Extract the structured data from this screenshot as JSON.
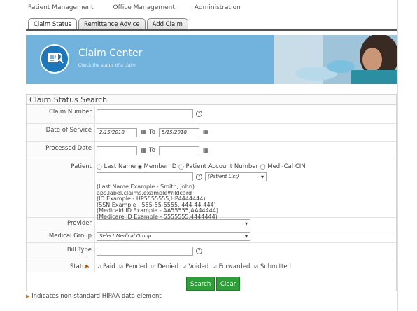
{
  "topnav": [
    "Patient Management",
    "Office Management",
    "Administration"
  ],
  "tabs": [
    "Claim Status",
    "Remittance Advice",
    "Add Claim"
  ],
  "banner": {
    "title": "Claim Center",
    "subtitle": "Check the status of a claim"
  },
  "form": {
    "title": "Claim Status Search",
    "claim_number": {
      "label": "Claim Number",
      "value": ""
    },
    "date_of_service": {
      "label": "Date of Service",
      "from": "2/15/2018",
      "to_label": "To",
      "to": "5/15/2018"
    },
    "processed_date": {
      "label": "Processed Date",
      "from": "",
      "to_label": "To",
      "to": ""
    },
    "patient": {
      "label": "Patient",
      "options": [
        "Last Name",
        "Member ID",
        "Patient Account Number",
        "Medi-Cal CIN"
      ],
      "selected": "Member ID",
      "value": "",
      "list_placeholder": "(Patient List)",
      "hints": [
        "(Last Name Example - Smith, John)",
        "aps.label.claims.exampleWildcard",
        "(ID Example - HP5555555,HP4444444)",
        "(SSN Example - 555-55-5555, 444-44-444)",
        "(Medicaid ID Example - AA55555,AA44444)",
        "(Medicare ID Example - 5555555,4444444)"
      ]
    },
    "provider": {
      "label": "Provider",
      "value": ""
    },
    "medical_group": {
      "label": "Medical Group",
      "value": "Select Medical Group"
    },
    "bill_type": {
      "label": "Bill Type",
      "value": ""
    },
    "status": {
      "label": "Status",
      "options": [
        "Paid",
        "Pended",
        "Denied",
        "Voided",
        "Forwarded",
        "Submitted"
      ]
    },
    "search_button": "Search",
    "clear_button": "Clear"
  },
  "footer_note": "Indicates non-standard HIPAA data element",
  "colors": {
    "banner": "#72b3de",
    "button": "#2f9e3a",
    "marker": "#d96b00"
  }
}
